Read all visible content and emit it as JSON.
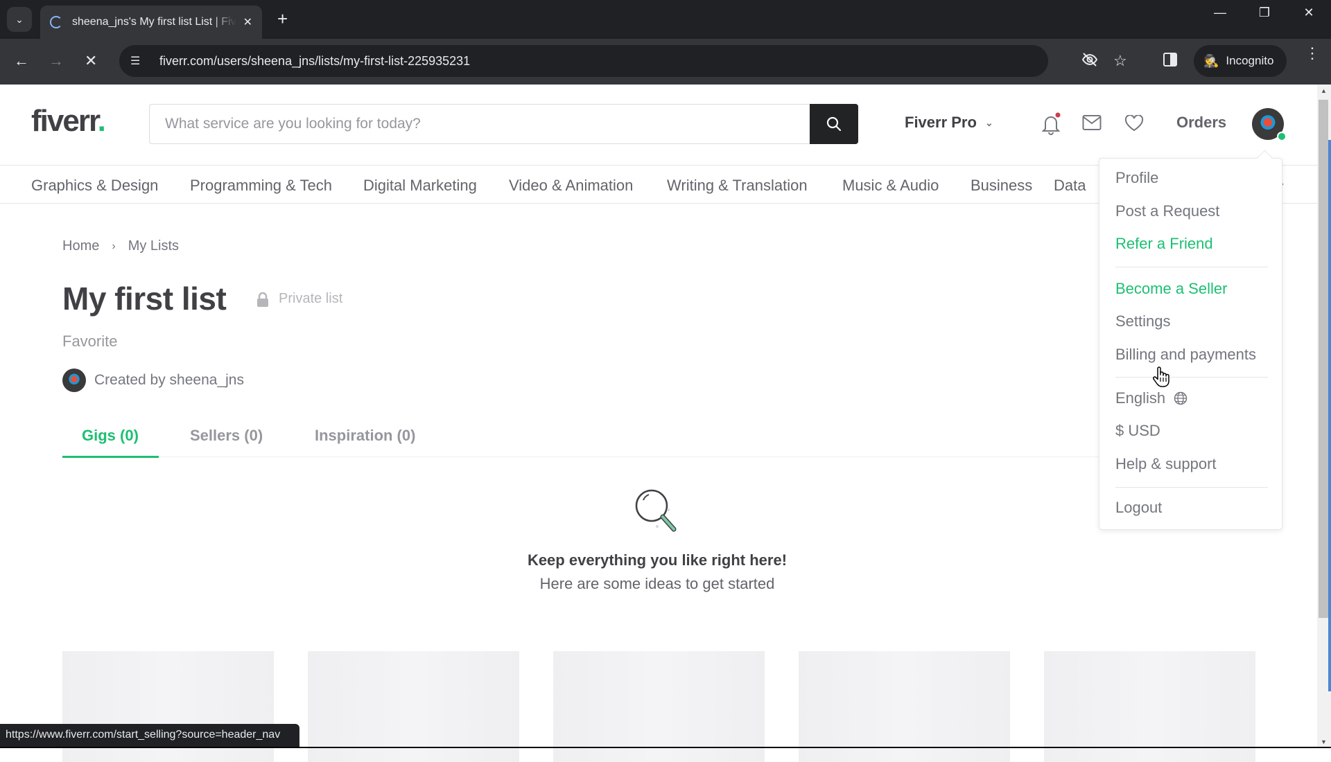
{
  "browser": {
    "tab_title": "sheena_jns's My first list List | Fiverr",
    "url": "fiverr.com/users/sheena_jns/lists/my-first-list-225935231",
    "incognito_label": "Incognito",
    "status_url": "https://www.fiverr.com/start_selling?source=header_nav"
  },
  "header": {
    "logo_text": "fiverr",
    "logo_dot": ".",
    "search_placeholder": "What service are you looking for today?",
    "search_value": "",
    "pro_label": "Fiverr Pro",
    "orders_label": "Orders",
    "notification_dot": true
  },
  "categories": [
    "Graphics & Design",
    "Programming & Tech",
    "Digital Marketing",
    "Video & Animation",
    "Writing & Translation",
    "Music & Audio",
    "Business",
    "Data"
  ],
  "breadcrumb": {
    "home": "Home",
    "current": "My Lists"
  },
  "list": {
    "title": "My first list",
    "privacy": "Private list",
    "description": "Favorite",
    "created_by": "Created by sheena_jns"
  },
  "tabs": [
    {
      "label": "Gigs (0)",
      "active": true
    },
    {
      "label": "Sellers (0)",
      "active": false
    },
    {
      "label": "Inspiration (0)",
      "active": false
    }
  ],
  "empty_state": {
    "heading": "Keep everything you like right here!",
    "subheading": "Here are some ideas to get started"
  },
  "user_menu": {
    "items": [
      {
        "label": "Profile",
        "highlight": false
      },
      {
        "label": "Post a Request",
        "highlight": false
      },
      {
        "label": "Refer a Friend",
        "highlight": true
      },
      {
        "label": "Become a Seller",
        "highlight": true
      },
      {
        "label": "Settings",
        "highlight": false
      },
      {
        "label": "Billing and payments",
        "highlight": false
      },
      {
        "label": "English",
        "highlight": false
      },
      {
        "label": "$ USD",
        "highlight": false
      },
      {
        "label": "Help & support",
        "highlight": false
      },
      {
        "label": "Logout",
        "highlight": false
      }
    ]
  },
  "colors": {
    "brand_green": "#1dbf73",
    "text_dark": "#404145",
    "text_muted": "#74767e"
  }
}
